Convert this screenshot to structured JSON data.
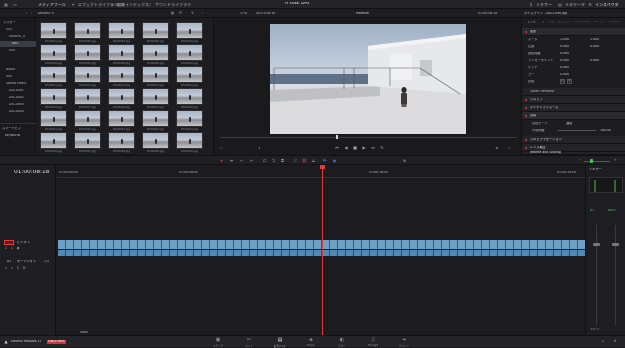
{
  "topbar": {
    "media_pool": "メディアプール",
    "effects_library": "エフェクトライブラリ",
    "edit_index": "編集インデックス",
    "sound_library": "サウンドライブラリ",
    "project_title": "A ONE DAY",
    "mixer": "ミキサー",
    "metadata": "メタデータ",
    "inspector": "インスペクタ"
  },
  "subbar": {
    "bin_path": "DESERT V",
    "zoom": "37%",
    "source_tc": "00:01:06:16",
    "timeline_name": "Material",
    "record_tc": "01:00:08:18",
    "inspector_target": "タイムライン - DSC1049.jpg"
  },
  "bins": {
    "items": [
      "マスター",
      "S02",
      "DESERT_V",
      "S03",
      "S04",
      "Audio",
      "S05",
      "Sound Effect",
      "DSC0001",
      "DSC0002",
      "DSC0003",
      "DSC0004"
    ],
    "smartbins_label": "スマートビン",
    "keywords_label": "Keywords"
  },
  "clips": [
    "DSC0001.jpg",
    "DSC0002.jpg",
    "DSC0003.jpg",
    "DSC0004.jpg",
    "DSC0005.jpg",
    "DSC0006.jpg",
    "DSC0007.jpg",
    "DSC0008.jpg",
    "DSC0009.jpg",
    "DSC0010.jpg",
    "DSC0011.jpg",
    "DSC0012.jpg",
    "DSC0013.jpg",
    "DSC0014.jpg",
    "DSC0015.jpg",
    "DSC0016.jpg",
    "DSC0017.jpg",
    "DSC0018.jpg",
    "DSC0019.jpg",
    "DSC0020.jpg",
    "DSC0021.jpg",
    "DSC0022.jpg",
    "DSC0023.jpg",
    "DSC0024.jpg",
    "DSC0025.jpg",
    "DSC0026.jpg",
    "DSC0027.jpg",
    "DSC0028.jpg",
    "DSC0029.jpg",
    "DSC0030.jpg"
  ],
  "inspector": {
    "tabs": [
      "ビデオ",
      "オーディオ",
      "エフェクト",
      "トランジション",
      "イメージ",
      "ファイル"
    ],
    "section_transform": "変形",
    "zoom_label": "ズーム",
    "zoom_x": "1.000",
    "zoom_y": "1.000",
    "position_label": "位置",
    "position_x": "0.000",
    "position_y": "0.000",
    "rotation_label": "回転角度",
    "rotation": "0.000",
    "anchor_label": "アンカーポイント",
    "anchor_x": "0.000",
    "anchor_y": "0.000",
    "pitch_label": "ピッチ",
    "pitch": "0.000",
    "yaw_label": "ヨー",
    "yaw": "0.000",
    "flip_label": "反転",
    "smart_reframe": "Smart Reframe",
    "crop": "クロップ",
    "dynamic_zoom": "ダイナミックズーム",
    "composite": "合成",
    "composite_mode_label": "合成モード",
    "composite_mode": "通常",
    "opacity_label": "不透明度",
    "opacity": "100.00",
    "stabilization": "スタビライゼーション",
    "lens_correction": "レンズ補正",
    "retime": "Retime and Scaling",
    "frame_interp_label": "リタイムプロセス",
    "frame_interp": "プロジェクト設定"
  },
  "timeline": {
    "timecode": "01:00:08:18",
    "ruler_marks": [
      "01:00:00:00",
      "01:00:08:00",
      "01:00:16:00",
      "01:00:24:00"
    ],
    "video_track_badge": "V1",
    "video_track_name": "ビデオ 1",
    "audio_track_badge": "A1",
    "audio_track_name": "オーディオ 1",
    "audio_level": "2.0"
  },
  "mixer": {
    "title": "ミキサー",
    "channel": "A1",
    "bus": "Bus1",
    "main": "メイン"
  },
  "bottombar": {
    "app_name": "DaVinci Resolve 17",
    "badge": "PUBLIC BETA",
    "pages": [
      "メディア",
      "カット",
      "エディット",
      "Fusion",
      "カラー",
      "Fairlight",
      "デリバー"
    ],
    "active_page_index": 2
  },
  "colors": {
    "accent_red": "#e0393e",
    "clip_video": "#6e9fc4",
    "clip_audio": "#4e8bb5",
    "panel_bg": "#1b1b1f"
  }
}
